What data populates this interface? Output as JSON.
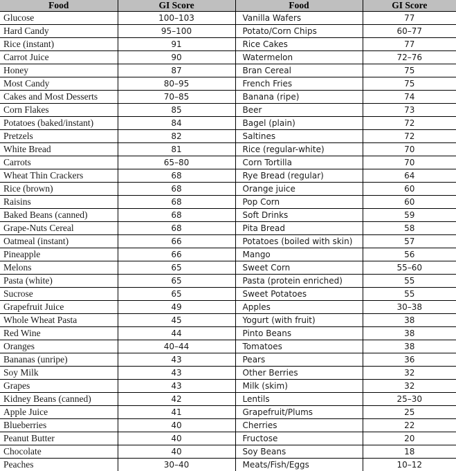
{
  "table": {
    "headers": {
      "food": "Food",
      "gi_score": "GI Score"
    },
    "columns": [
      {
        "key": "food_left",
        "label": "Food"
      },
      {
        "key": "score_left",
        "label": "GI Score"
      },
      {
        "key": "food_right",
        "label": "Food"
      },
      {
        "key": "score_right",
        "label": "GI Score"
      }
    ],
    "header_background": "#bfbfbf",
    "border_color": "#000000",
    "row_count": 36,
    "rows": [
      {
        "food_left": "Glucose",
        "score_left": "100–103",
        "food_right": "Vanilla Wafers",
        "score_right": "77"
      },
      {
        "food_left": "Hard Candy",
        "score_left": "95–100",
        "food_right": "Potato/Corn Chips",
        "score_right": "60–77"
      },
      {
        "food_left": "Rice (instant)",
        "score_left": "91",
        "food_right": "Rice Cakes",
        "score_right": "77"
      },
      {
        "food_left": "Carrot Juice",
        "score_left": "90",
        "food_right": "Watermelon",
        "score_right": "72–76"
      },
      {
        "food_left": "Honey",
        "score_left": "87",
        "food_right": "Bran Cereal",
        "score_right": "75"
      },
      {
        "food_left": "Most Candy",
        "score_left": "80–95",
        "food_right": "French Fries",
        "score_right": "75"
      },
      {
        "food_left": "Cakes and Most Desserts",
        "score_left": "70–85",
        "food_right": "Banana (ripe)",
        "score_right": "74"
      },
      {
        "food_left": "Corn Flakes",
        "score_left": "85",
        "food_right": "Beer",
        "score_right": "73"
      },
      {
        "food_left": "Potatoes (baked/instant)",
        "score_left": "84",
        "food_right": "Bagel (plain)",
        "score_right": "72"
      },
      {
        "food_left": "Pretzels",
        "score_left": "82",
        "food_right": "Saltines",
        "score_right": "72"
      },
      {
        "food_left": "White Bread",
        "score_left": "81",
        "food_right": "Rice (regular-white)",
        "score_right": "70"
      },
      {
        "food_left": "Carrots",
        "score_left": "65–80",
        "food_right": "Corn Tortilla",
        "score_right": "70"
      },
      {
        "food_left": "Wheat Thin Crackers",
        "score_left": "68",
        "food_right": "Rye Bread (regular)",
        "score_right": "64"
      },
      {
        "food_left": "Rice (brown)",
        "score_left": "68",
        "food_right": "Orange juice",
        "score_right": "60"
      },
      {
        "food_left": "Raisins",
        "score_left": "68",
        "food_right": "Pop Corn",
        "score_right": "60"
      },
      {
        "food_left": "Baked Beans (canned)",
        "score_left": "68",
        "food_right": "Soft Drinks",
        "score_right": "59"
      },
      {
        "food_left": "Grape-Nuts Cereal",
        "score_left": "68",
        "food_right": "Pita Bread",
        "score_right": "58"
      },
      {
        "food_left": "Oatmeal (instant)",
        "score_left": "66",
        "food_right": "Potatoes (boiled with skin)",
        "score_right": "57"
      },
      {
        "food_left": "Pineapple",
        "score_left": "66",
        "food_right": "Mango",
        "score_right": "56"
      },
      {
        "food_left": "Melons",
        "score_left": "65",
        "food_right": "Sweet Corn",
        "score_right": "55–60"
      },
      {
        "food_left": "Pasta (white)",
        "score_left": "65",
        "food_right": "Pasta (protein enriched)",
        "score_right": "55"
      },
      {
        "food_left": "Sucrose",
        "score_left": "65",
        "food_right": "Sweet Potatoes",
        "score_right": "55"
      },
      {
        "food_left": "Grapefruit Juice",
        "score_left": "49",
        "food_right": "Apples",
        "score_right": "30–38"
      },
      {
        "food_left": "Whole Wheat Pasta",
        "score_left": "45",
        "food_right": "Yogurt (with fruit)",
        "score_right": "38"
      },
      {
        "food_left": "Red Wine",
        "score_left": "44",
        "food_right": "Pinto Beans",
        "score_right": "38"
      },
      {
        "food_left": "Oranges",
        "score_left": "40–44",
        "food_right": "Tomatoes",
        "score_right": "38"
      },
      {
        "food_left": "Bananas (unripe)",
        "score_left": "43",
        "food_right": "Pears",
        "score_right": "36"
      },
      {
        "food_left": "Soy Milk",
        "score_left": "43",
        "food_right": "Other Berries",
        "score_right": "32"
      },
      {
        "food_left": "Grapes",
        "score_left": "43",
        "food_right": "Milk (skim)",
        "score_right": "32"
      },
      {
        "food_left": "Kidney Beans (canned)",
        "score_left": "42",
        "food_right": "Lentils",
        "score_right": "25–30"
      },
      {
        "food_left": "Apple Juice",
        "score_left": "41",
        "food_right": "Grapefruit/Plums",
        "score_right": "25"
      },
      {
        "food_left": "Blueberries",
        "score_left": "40",
        "food_right": "Cherries",
        "score_right": "22"
      },
      {
        "food_left": "Peanut Butter",
        "score_left": "40",
        "food_right": "Fructose",
        "score_right": "20"
      },
      {
        "food_left": "Chocolate",
        "score_left": "40",
        "food_right": "Soy Beans",
        "score_right": "18"
      },
      {
        "food_left": "Peaches",
        "score_left": "30–40",
        "food_right": "Meats/Fish/Eggs",
        "score_right": "10–12"
      }
    ]
  }
}
